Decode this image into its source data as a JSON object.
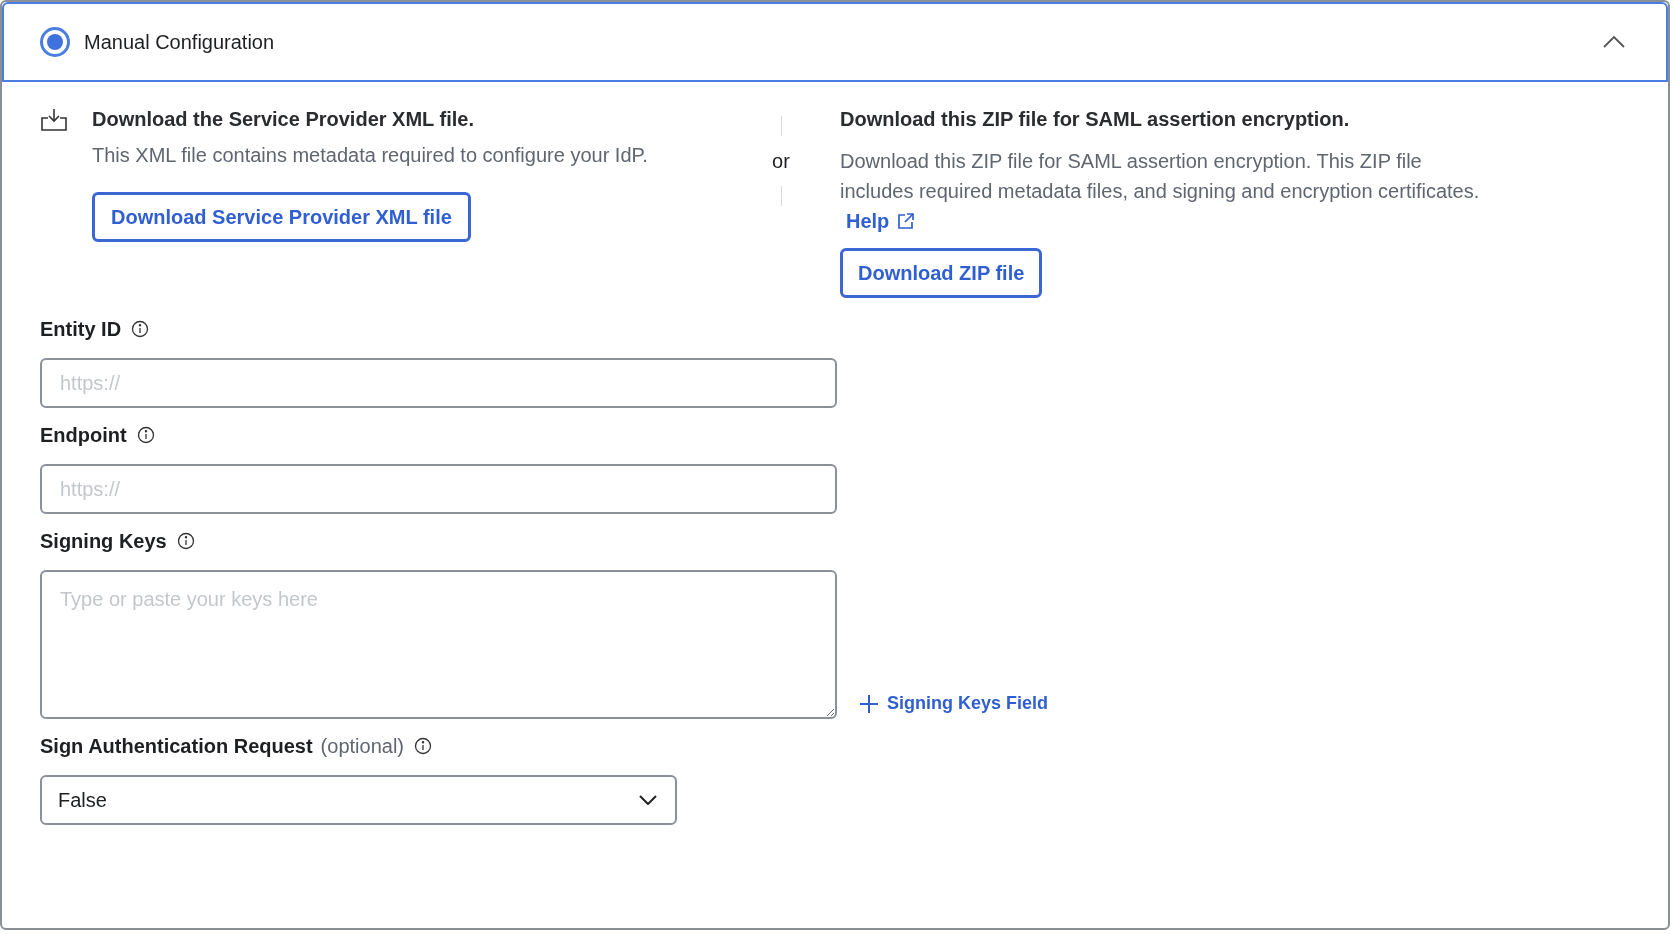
{
  "panel": {
    "title": "Manual Configuration",
    "selected": true,
    "expanded": true
  },
  "xml_download": {
    "title": "Download the Service Provider XML file.",
    "description": "This XML file contains metadata required to configure your IdP.",
    "button": "Download Service Provider XML file"
  },
  "separator": "or",
  "zip_download": {
    "title": "Download this ZIP file for SAML assertion encryption.",
    "description": "Download this ZIP file for SAML assertion encryption. This ZIP file includes required metadata files, and signing and encryption certificates.",
    "help_link": "Help",
    "button": "Download ZIP file"
  },
  "fields": [
    {
      "kind": "input",
      "label": "Entity ID",
      "placeholder": "https://"
    },
    {
      "kind": "input",
      "label": "Endpoint",
      "placeholder": "https://"
    },
    {
      "kind": "textarea",
      "label": "Signing Keys",
      "placeholder": "Type or paste your keys here",
      "add_link": "Signing Keys Field"
    },
    {
      "kind": "select",
      "label": "Sign Authentication Request",
      "note": "(optional)",
      "value": "False"
    }
  ]
}
